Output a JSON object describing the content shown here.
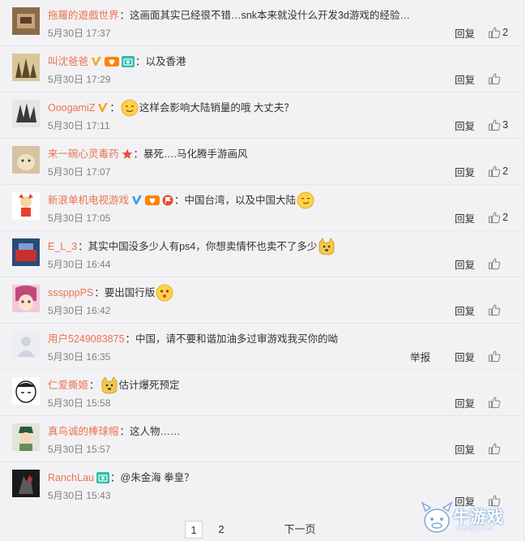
{
  "comments": [
    {
      "user": "拖羅的遊戲世界",
      "badges": [],
      "text_before": "这画面其实已经很不错…snk本来就没什么开发3d游戏的经验…",
      "emoji": "",
      "text_after": "",
      "time": "5月30日 17:37",
      "report": "",
      "reply": "回复",
      "likes": "2"
    },
    {
      "user": "叫沈爸爸",
      "badges": [
        "verified-yellow-icon",
        "fans-heart-icon",
        "camera-icon"
      ],
      "text_before": "以及香港",
      "emoji": "",
      "text_after": "",
      "time": "5月30日 17:29",
      "report": "",
      "reply": "回复",
      "likes": ""
    },
    {
      "user": "OoogamiZ",
      "badges": [
        "verified-yellow-icon"
      ],
      "text_before": "",
      "emoji": "sweat-smile-emoji",
      "text_after": "这样会影响大陆销量的哦 大丈夫？",
      "time": "5月30日 17:11",
      "report": "",
      "reply": "回复",
      "likes": "3"
    },
    {
      "user": "来一碗心灵毒药",
      "badges": [
        "red-star-icon"
      ],
      "text_before": "暴死….马化腾手游画风",
      "emoji": "",
      "text_after": "",
      "time": "5月30日 17:07",
      "report": "",
      "reply": "回复",
      "likes": "2"
    },
    {
      "user": "新浪单机电视游戏",
      "badges": [
        "verified-blue-icon",
        "fans-heart-icon",
        "red-flag-icon"
      ],
      "text_before": "中国台湾，以及中国大陆",
      "emoji": "smirk-emoji",
      "text_after": "",
      "time": "5月30日 17:05",
      "report": "",
      "reply": "回复",
      "likes": "2"
    },
    {
      "user": "E_L_3",
      "badges": [],
      "text_before": "其实中国没多少人有ps4，你想卖情怀也卖不了多少",
      "emoji": "doge-emoji",
      "text_after": "",
      "time": "5月30日 16:44",
      "report": "",
      "reply": "回复",
      "likes": ""
    },
    {
      "user": "ssspppPS",
      "badges": [],
      "text_before": "要出国行版",
      "emoji": "kiss-emoji",
      "text_after": "",
      "time": "5月30日 16:42",
      "report": "",
      "reply": "回复",
      "likes": ""
    },
    {
      "user": "用户5249083875",
      "badges": [],
      "text_before": "中国，请不要和谐加油多过审游戏我买你的呦",
      "emoji": "",
      "text_after": "",
      "time": "5月30日 16:35",
      "report": "举报",
      "reply": "回复",
      "likes": ""
    },
    {
      "user": "仁爱撕姬",
      "badges": [],
      "text_before": "",
      "emoji": "doge-emoji",
      "text_after": "估计爆死预定",
      "time": "5月30日 15:58",
      "report": "",
      "reply": "回复",
      "likes": ""
    },
    {
      "user": "真鸟诚的棒球帽",
      "badges": [],
      "text_before": "这人物……",
      "emoji": "",
      "text_after": "",
      "time": "5月30日 15:57",
      "report": "",
      "reply": "回复",
      "likes": ""
    },
    {
      "user": "RanchLau",
      "badges": [
        "camera-icon"
      ],
      "text_before": "@朱金海 拳皇？",
      "emoji": "",
      "text_after": "",
      "time": "5月30日 15:43",
      "report": "",
      "reply": "回复",
      "likes": ""
    }
  ],
  "pager": {
    "page1": "1",
    "page2": "2",
    "next": "下一页"
  },
  "watermark": {
    "text": "牛游戏",
    "url": "newyx.net"
  },
  "colors": {
    "username": "#eb7350",
    "background": "#f2f2f5",
    "text": "#333333",
    "time": "#808080"
  }
}
